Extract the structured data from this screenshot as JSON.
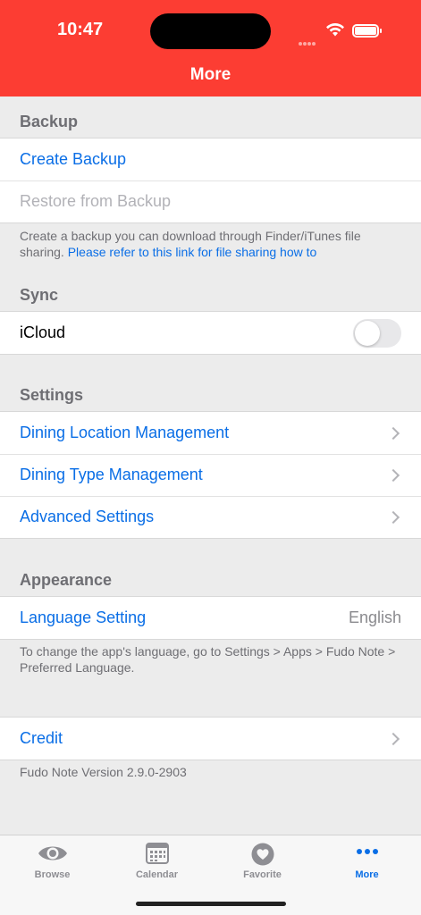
{
  "status": {
    "time": "10:47"
  },
  "nav": {
    "title": "More"
  },
  "backup": {
    "header": "Backup",
    "create": "Create Backup",
    "restore": "Restore from Backup",
    "footer_text": "Create a backup you can download through Finder/iTunes file sharing. ",
    "footer_link": "Please refer to this link for file sharing how to"
  },
  "sync": {
    "header": "Sync",
    "icloud": "iCloud",
    "icloud_enabled": false
  },
  "settings": {
    "header": "Settings",
    "items": [
      {
        "label": "Dining Location Management"
      },
      {
        "label": "Dining Type Management"
      },
      {
        "label": "Advanced Settings"
      }
    ]
  },
  "appearance": {
    "header": "Appearance",
    "language_label": "Language Setting",
    "language_value": "English",
    "footer": "To change the app's language, go to Settings > Apps > Fudo Note > Preferred Language."
  },
  "credit": {
    "label": "Credit",
    "version": "Fudo Note Version 2.9.0-2903"
  },
  "tabbar": {
    "tabs": [
      {
        "label": "Browse",
        "icon": "eye-icon"
      },
      {
        "label": "Calendar",
        "icon": "calendar-icon"
      },
      {
        "label": "Favorite",
        "icon": "heart-icon"
      },
      {
        "label": "More",
        "icon": "ellipsis-icon"
      }
    ],
    "active_index": 3
  },
  "colors": {
    "accent": "#0a6ee6",
    "header": "#fc3d33",
    "background": "#ececec"
  }
}
